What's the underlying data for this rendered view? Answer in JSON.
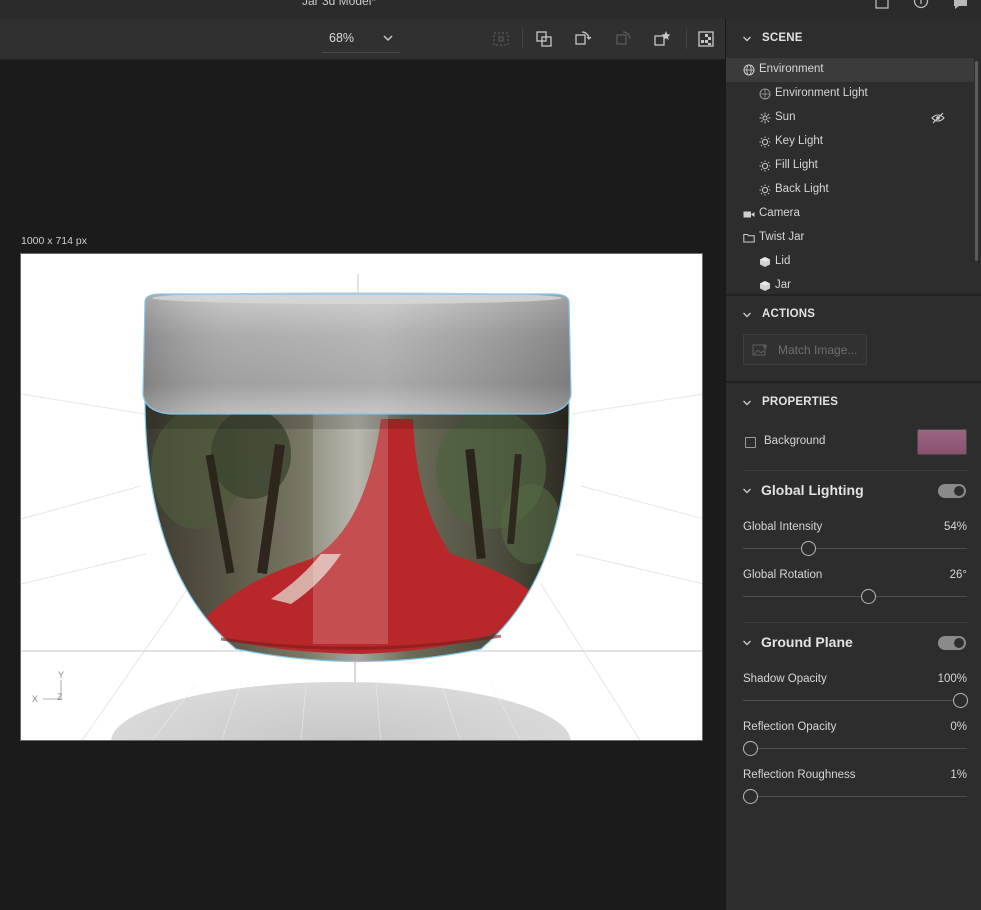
{
  "window": {
    "title": "Jar 3d Model*"
  },
  "toolbar": {
    "zoom": "68%",
    "tools": [
      "select-frame-icon",
      "transform-icon",
      "orbit-icon",
      "pan-icon",
      "add-light-icon",
      "render-icon"
    ]
  },
  "canvas": {
    "dimensions_label": "1000 x 714 px",
    "axis_labels": {
      "x": "X",
      "y": "Y",
      "z": "Z"
    }
  },
  "scene": {
    "header": "SCENE",
    "items": [
      {
        "label": "Environment",
        "icon": "globe-icon",
        "level": 0,
        "selected": true
      },
      {
        "label": "Environment Light",
        "icon": "environment-light-icon",
        "level": 1
      },
      {
        "label": "Sun",
        "icon": "sun-icon",
        "level": 1,
        "hidden": true
      },
      {
        "label": "Key Light",
        "icon": "light-bulb-icon",
        "level": 1
      },
      {
        "label": "Fill Light",
        "icon": "light-bulb-icon",
        "level": 1
      },
      {
        "label": "Back Light",
        "icon": "light-bulb-icon",
        "level": 1
      },
      {
        "label": "Camera",
        "icon": "camera-icon",
        "level": 0
      },
      {
        "label": "Twist Jar",
        "icon": "folder-icon",
        "level": 0
      },
      {
        "label": "Lid",
        "icon": "mesh-icon",
        "level": 1
      },
      {
        "label": "Jar",
        "icon": "mesh-icon",
        "level": 1
      }
    ]
  },
  "actions": {
    "header": "ACTIONS",
    "match_image_label": "Match Image..."
  },
  "properties": {
    "header": "PROPERTIES",
    "background_label": "Background",
    "background_checked": false,
    "background_color": "#8a5070"
  },
  "global_lighting": {
    "title": "Global Lighting",
    "enabled": true,
    "intensity_label": "Global Intensity",
    "intensity_value": "54%",
    "intensity_fraction": 0.29,
    "rotation_label": "Global Rotation",
    "rotation_value": "26°",
    "rotation_fraction": 0.56
  },
  "ground_plane": {
    "title": "Ground Plane",
    "enabled": true,
    "shadow_opacity_label": "Shadow Opacity",
    "shadow_opacity_value": "100%",
    "shadow_opacity_fraction": 1.0,
    "reflection_opacity_label": "Reflection Opacity",
    "reflection_opacity_value": "0%",
    "reflection_opacity_fraction": 0.0,
    "reflection_roughness_label": "Reflection Roughness",
    "reflection_roughness_value": "1%",
    "reflection_roughness_fraction": 0.01
  },
  "colors": {
    "panel_bg": "#2d2d2d",
    "workspace_bg": "#1b1b1b",
    "jar_red": "#b8282a",
    "lid_grey": "#a8a8a8",
    "selection_outline": "#7fc6ea"
  }
}
